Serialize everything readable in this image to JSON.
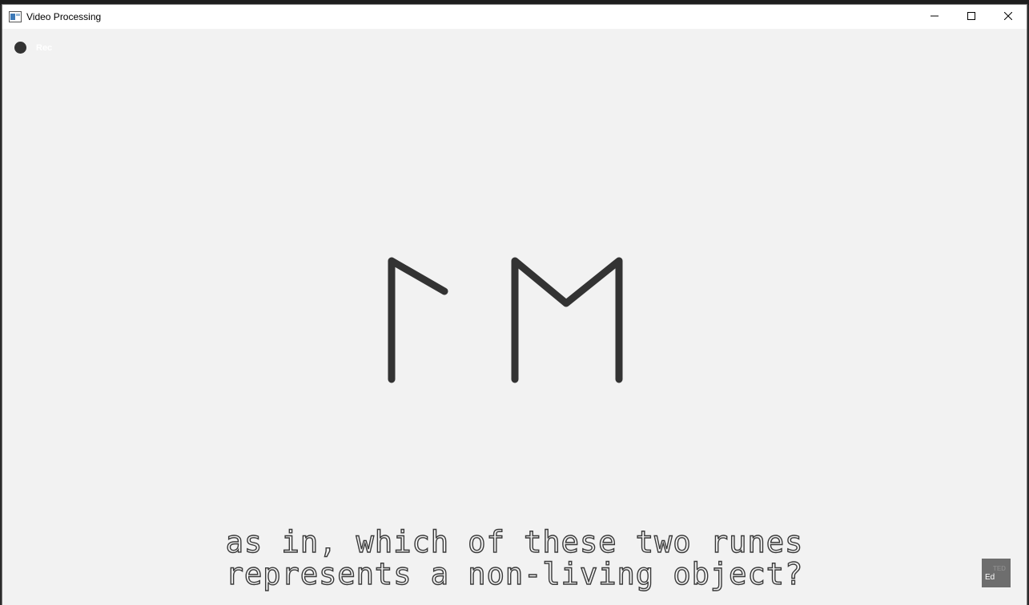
{
  "window": {
    "title": "Video Processing",
    "app_icon": "window-app-icon",
    "controls": {
      "minimize_icon": "minimize-icon",
      "maximize_icon": "maximize-icon",
      "close_icon": "close-icon"
    }
  },
  "video": {
    "rec_label": "Rec",
    "rune_stroke_color": "#333333",
    "background_color": "#f2f2f2",
    "subtitles": [
      "as in, which of these two runes",
      "represents a non-living object?"
    ],
    "badge": {
      "top": "TED",
      "bottom": "Ed"
    }
  }
}
